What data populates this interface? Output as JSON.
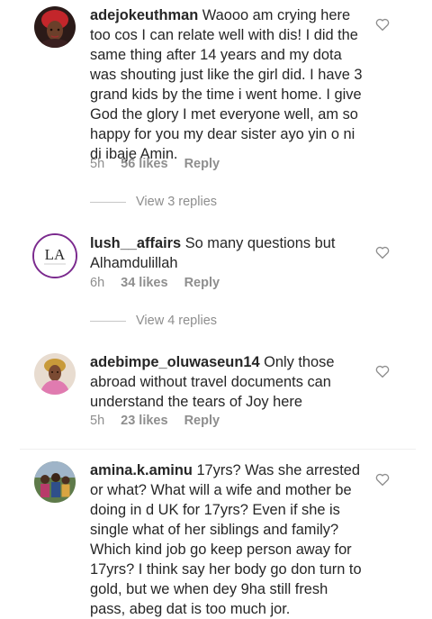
{
  "comments": [
    {
      "username": "adejokeuthman",
      "text": "Waooo am crying here too cos I can relate well with dis! I did the same thing after 14 years and my dota was shouting just like the girl did. I have 3 grand kids by the time i went home. I give God the glory I met everyone well, am so happy for you my dear sister ayo yin o ni di ibaje Amin.",
      "time": "5h",
      "likes": "56 likes",
      "reply": "Reply",
      "view_replies": "View 3 replies",
      "avatar": "woman-red-headwrap-avatar"
    },
    {
      "username": "lush__affairs",
      "text": "So many questions but Alhamdulillah",
      "time": "6h",
      "likes": "34 likes",
      "reply": "Reply",
      "view_replies": "View 4 replies",
      "avatar": "la-logo-avatar",
      "avatar_logo_text": "LA",
      "avatar_ring_color": "#7b2a8e"
    },
    {
      "username": "adebimpe_oluwaseun14",
      "text": "Only those abroad without travel documents can understand the tears of Joy here",
      "time": "5h",
      "likes": "23 likes",
      "reply": "Reply",
      "avatar": "woman-pink-outfit-avatar"
    },
    {
      "username": "amina.k.aminu",
      "text": "17yrs? Was she arrested or what? What will a wife and mother be doing in d UK for 17yrs? Even if she is single what of her siblings and family? Which kind job go keep person away for 17yrs? I think say her body go don turn to gold, but we when dey 9ha still fresh pass, abeg dat is too much jor.",
      "avatar": "group-photo-avatar"
    }
  ],
  "colors": {
    "text": "#262626",
    "secondary": "#8e8e8e",
    "separator": "#efefef"
  }
}
